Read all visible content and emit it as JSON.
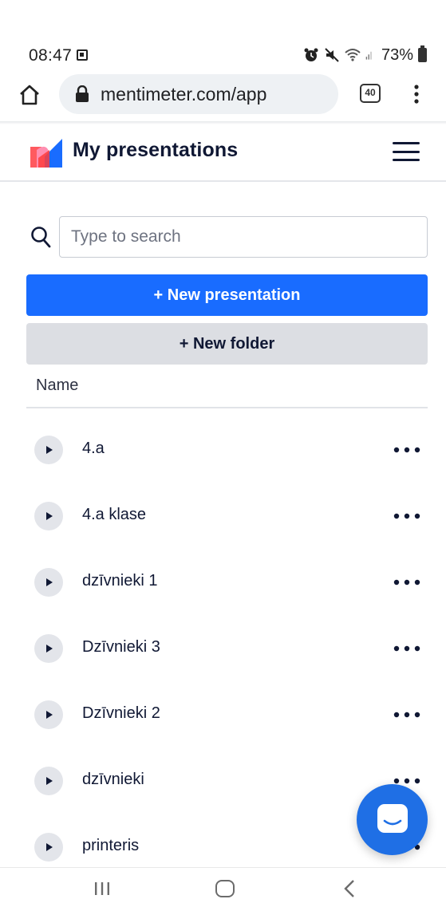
{
  "status": {
    "time": "08:47",
    "battery": "73%"
  },
  "browser": {
    "url": "mentimeter.com/app",
    "tab_count": "40"
  },
  "header": {
    "title": "My presentations"
  },
  "search": {
    "placeholder": "Type to search"
  },
  "actions": {
    "new_presentation": "+ New presentation",
    "new_folder": "+ New folder"
  },
  "list": {
    "column_header": "Name",
    "items": [
      {
        "label": "4.a"
      },
      {
        "label": "4.a klase"
      },
      {
        "label": "dzīvnieki 1"
      },
      {
        "label": "Dzīvnieki 3"
      },
      {
        "label": "Dzīvnieki 2"
      },
      {
        "label": "dzīvnieki"
      },
      {
        "label": "printeris"
      }
    ]
  },
  "colors": {
    "primary": "#196cff",
    "secondary_button": "#dcdee3",
    "chat_button": "#1f6fe5",
    "text": "#101834"
  },
  "icons": {
    "home": "home-icon",
    "lock": "lock-icon",
    "menu": "hamburger-menu-icon",
    "search": "search-icon",
    "play": "play-icon",
    "more": "more-horizontal-icon",
    "chat": "chat-icon"
  }
}
